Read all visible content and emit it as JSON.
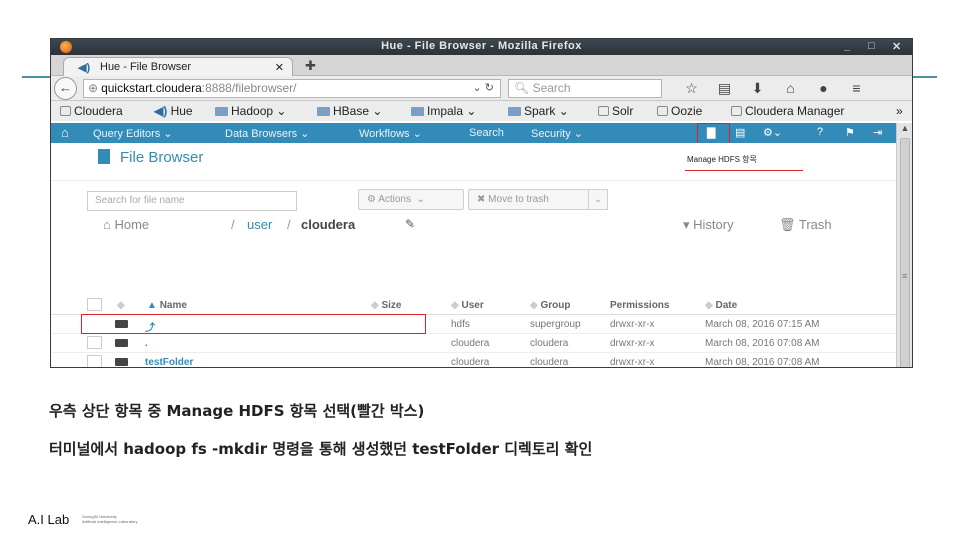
{
  "browser": {
    "window_title": "Hue - File Browser - Mozilla Firefox",
    "tab_title": "Hue - File Browser",
    "url_domain": "quickstart.cloudera",
    "url_path": ":8888/filebrowser/",
    "search_placeholder": "Search",
    "window_controls": [
      "_",
      "□",
      "✕"
    ]
  },
  "bookmarks": [
    "Cloudera",
    "Hue",
    "Hadoop",
    "HBase",
    "Impala",
    "Spark",
    "Solr",
    "Oozie",
    "Cloudera Manager"
  ],
  "hue_nav": {
    "items": [
      "Query Editors",
      "Data Browsers",
      "Workflows",
      "Search",
      "Security"
    ],
    "tooltip": "Manage HDFS 항목"
  },
  "file_browser": {
    "title": "File Browser",
    "search_placeholder": "Search for file name",
    "actions_label": "Actions",
    "trash_button": "Move to trash",
    "breadcrumb": {
      "home": "Home",
      "user": "user",
      "current": "cloudera"
    },
    "history": "History",
    "trash": "Trash",
    "columns": [
      "Name",
      "Size",
      "User",
      "Group",
      "Permissions",
      "Date"
    ],
    "rows": [
      {
        "name": "",
        "user": "hdfs",
        "group": "supergroup",
        "perms": "drwxr-xr-x",
        "date": "March 08, 2016 07:15 AM"
      },
      {
        "name": ".",
        "user": "cloudera",
        "group": "cloudera",
        "perms": "drwxr-xr-x",
        "date": "March 08, 2016 07:08 AM"
      },
      {
        "name": "testFolder",
        "user": "cloudera",
        "group": "cloudera",
        "perms": "drwxr-xr-x",
        "date": "March 08, 2016 07:08 AM"
      }
    ]
  },
  "slide": {
    "caption1": "우측 상단 항목 중 Manage HDFS 항목 선택(빨간 박스)",
    "caption2": "터미널에서 hadoop fs -mkdir 명령을 통해 생성했던 testFolder 디렉토리 확인",
    "logo_main": "A.I Lab",
    "logo_sub1": "SoongSil University",
    "logo_sub2": "Artificial Intelligence Laboratory"
  },
  "colors": {
    "hue_blue": "#338bb8",
    "highlight_red": "#e0202a",
    "accent_line": "#4a90a4"
  }
}
